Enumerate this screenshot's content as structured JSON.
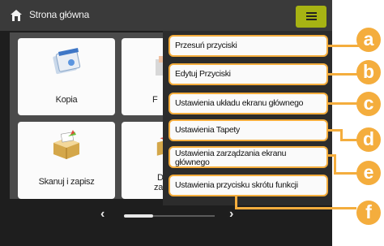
{
  "header": {
    "title": "Strona główna"
  },
  "tiles": [
    {
      "label": "Kopia"
    },
    {
      "label": "F"
    },
    {
      "label": "Skanuj i zapisz"
    },
    {
      "label_line1": "Do",
      "label_line2": "zapi."
    }
  ],
  "menu": {
    "items": [
      {
        "label": "Przesuń przyciski",
        "callout": "a"
      },
      {
        "label": "Edytuj Przyciski",
        "callout": "b"
      },
      {
        "label": "Ustawienia układu ekranu głównego",
        "callout": "c"
      },
      {
        "label": "Ustawienia Tapety",
        "callout": "d"
      },
      {
        "label": "Ustawienia zarządzania ekranu głównego",
        "callout": "e"
      },
      {
        "label": "Ustawienia przycisku skrótu funkcji",
        "callout": "f"
      }
    ]
  },
  "pager": {
    "prev": "‹",
    "next": "›"
  },
  "colors": {
    "accent": "#f4ad3d",
    "menu_button": "#a7b313",
    "background": "#1e1e1e"
  },
  "icons": [
    "home-icon",
    "menu-icon",
    "copy-icon",
    "scan-and-store-icon"
  ]
}
